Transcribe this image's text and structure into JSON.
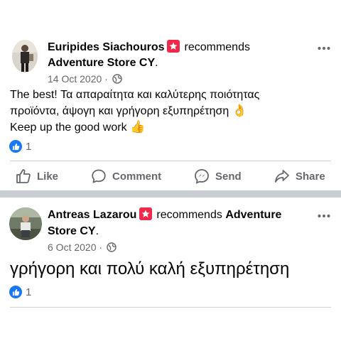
{
  "posts": [
    {
      "author": "Euripides Siachouros",
      "verb": "recommends",
      "page": "Adventure Store CY",
      "date": "14 Oct 2020",
      "separator_dot": "·",
      "text_line1": "The best! Τα απαραίτητα και καλύτερης ποιότητας",
      "text_line2": "προϊόντα, άψογη και γρήγορη εξυπηρέτηση",
      "text_line2_emoji": "👌",
      "text_line3": "Keep up the good work",
      "text_line3_emoji": "👍",
      "like_count": "1",
      "actions": {
        "like": "Like",
        "comment": "Comment",
        "send": "Send",
        "share": "Share"
      }
    },
    {
      "author": "Antreas Lazarou",
      "verb": "recommends",
      "page_part1": "Adventure",
      "page_part2": "Store CY",
      "date": "6 Oct 2020",
      "separator_dot": "·",
      "text": "γρήγορη και πολύ καλή εξυπηρέτηση",
      "like_count": "1"
    }
  ],
  "colors": {
    "badge": "#f02849",
    "like_blue": "#1877f2",
    "secondary_text": "#65676b",
    "separator": "#c9ccd1"
  },
  "icons": [
    "recommendation-badge-icon",
    "globe-icon",
    "more-options-icon",
    "like-reaction-icon",
    "like-icon",
    "comment-icon",
    "send-icon",
    "share-icon"
  ]
}
